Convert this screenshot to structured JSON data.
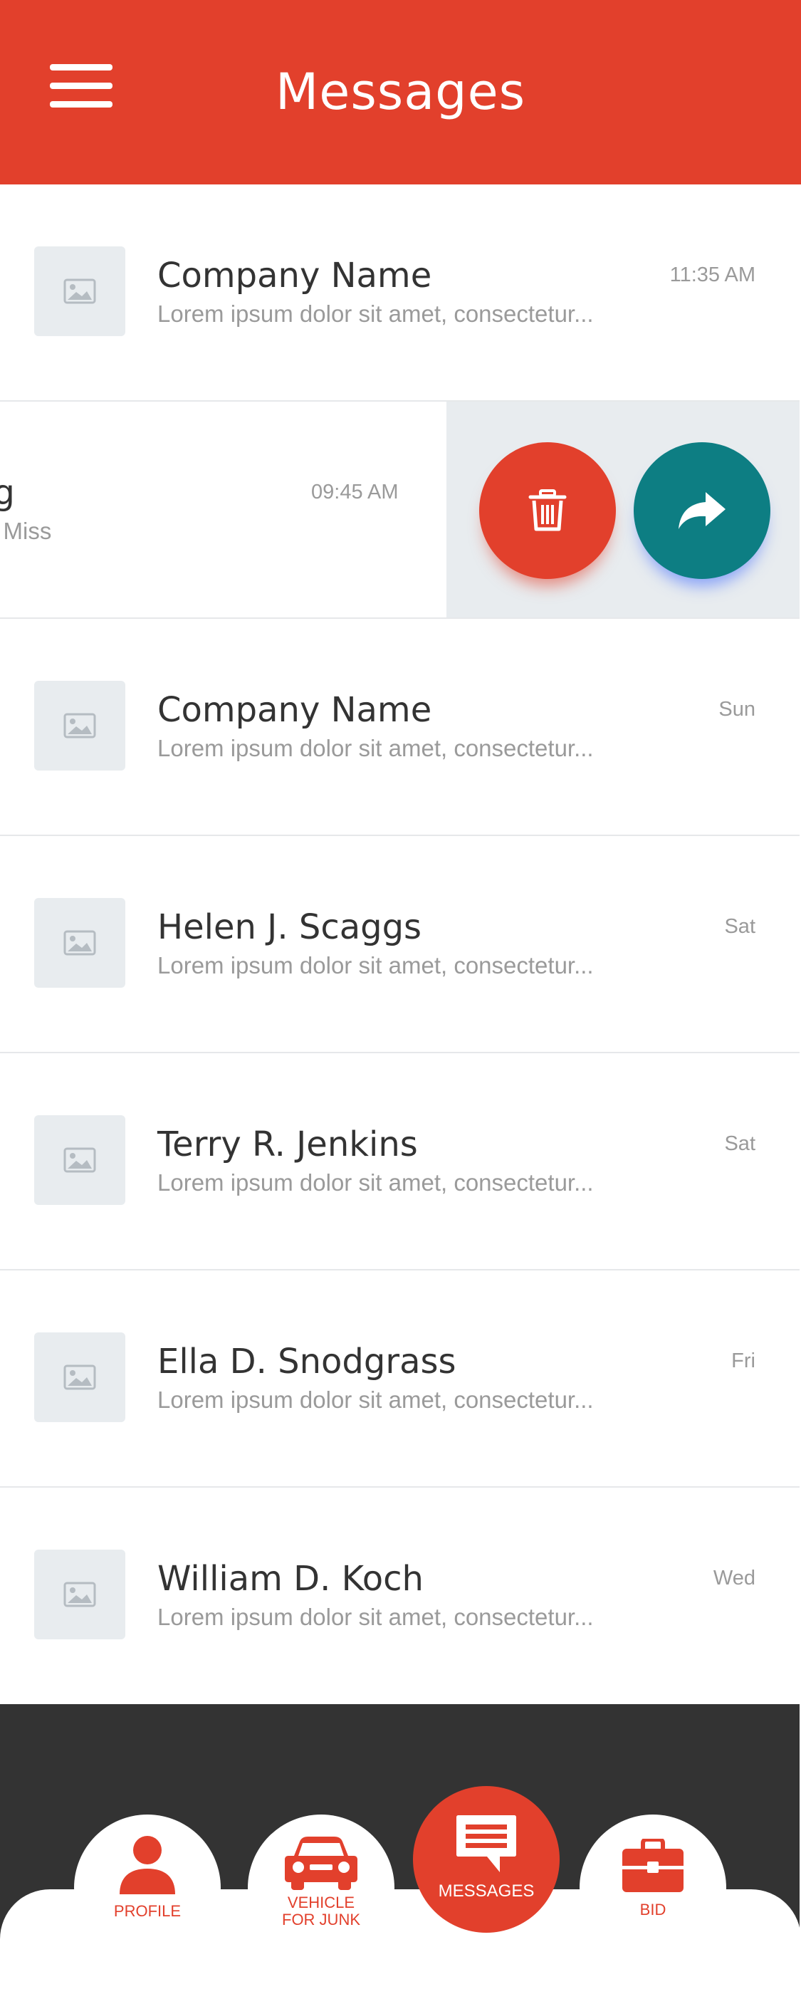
{
  "header": {
    "title": "Messages",
    "menu_icon": "hamburger-menu-icon"
  },
  "messages": [
    {
      "name": "Company Name",
      "preview": "Lorem ipsum dolor sit amet, consectetur...",
      "time": "11:35 AM"
    },
    {
      "name": "Company Name",
      "preview": "Lorem ipsum dolor sit amet, consectetur...",
      "time": "Sun"
    },
    {
      "name": "Helen J. Scaggs",
      "preview": "Lorem ipsum dolor sit amet, consectetur...",
      "time": "Sat"
    },
    {
      "name": "Terry R. Jenkins",
      "preview": "Lorem ipsum dolor sit amet, consectetur...",
      "time": "Sat"
    },
    {
      "name": "Ella D. Snodgrass",
      "preview": "Lorem ipsum dolor sit amet, consectetur...",
      "time": "Fri"
    },
    {
      "name": "William D. Koch",
      "preview": "Lorem ipsum dolor sit amet, consectetur...",
      "time": "Wed"
    }
  ],
  "swiped_row": {
    "name_visible": "ng",
    "preview_visible": "or Miss",
    "time": "09:45 AM",
    "delete_icon": "trash-icon",
    "forward_icon": "forward-arrow-icon"
  },
  "bottom_nav": {
    "profile": "PROFILE",
    "vehicle_line1": "VEHICLE",
    "vehicle_line2": "FOR JUNK",
    "messages": "MESSAGES",
    "bid": "BID"
  },
  "colors": {
    "accent": "#e2402c",
    "teal": "#0d7e83",
    "bottom_bar": "#333333",
    "thumb_bg": "#e8ecef"
  }
}
